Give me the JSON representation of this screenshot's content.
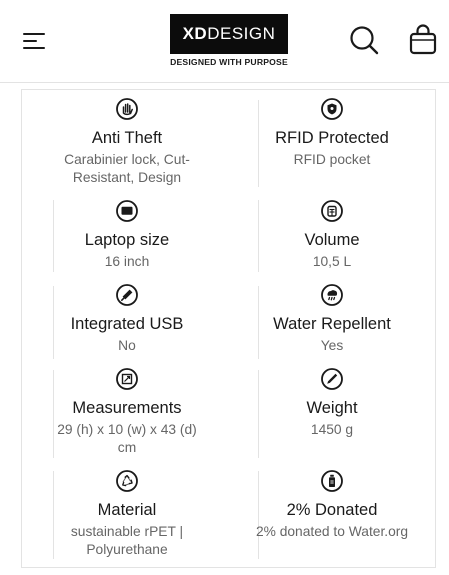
{
  "header": {
    "logo_bold": "XD",
    "logo_light": "DESIGN",
    "tagline": "DESIGNED WITH PURPOSE"
  },
  "features": [
    {
      "icon": "anti-theft-hand-icon",
      "title": "Anti Theft",
      "value": "Carabinier lock, Cut-Resistant, Design"
    },
    {
      "icon": "rfid-shield-icon",
      "title": "RFID Protected",
      "value": "RFID pocket"
    },
    {
      "icon": "laptop-icon",
      "title": "Laptop size",
      "value": "16 inch"
    },
    {
      "icon": "volume-icon",
      "title": "Volume",
      "value": "10,5 L"
    },
    {
      "icon": "usb-icon",
      "title": "Integrated USB",
      "value": "No"
    },
    {
      "icon": "water-repellent-icon",
      "title": "Water Repellent",
      "value": "Yes"
    },
    {
      "icon": "measurements-icon",
      "title": "Measurements",
      "value": "29 (h) x 10 (w) x 43 (d) cm"
    },
    {
      "icon": "weight-icon",
      "title": "Weight",
      "value": "1450 g"
    },
    {
      "icon": "recycle-icon",
      "title": "Material",
      "value": "sustainable rPET | Polyurethane"
    },
    {
      "icon": "donation-bottle-icon",
      "title": "2% Donated",
      "value": "2% donated to Water.org"
    }
  ]
}
